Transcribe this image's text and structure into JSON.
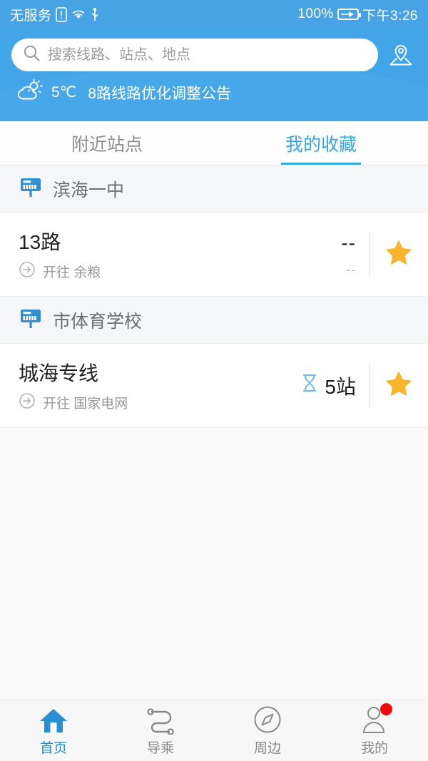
{
  "statusbar": {
    "carrier": "无服务",
    "sim_icon": "sim-alert-icon",
    "wifi_icon": "wifi-icon",
    "usb_icon": "usb-icon",
    "battery_percent": "100%",
    "battery_icon": "battery-charging-icon",
    "time": "下午3:26"
  },
  "header": {
    "search": {
      "icon": "search-icon",
      "placeholder": "搜索线路、站点、地点",
      "value": ""
    },
    "map_icon": "map-pin-icon",
    "weather": {
      "icon": "sun-cloud-icon",
      "temperature": "5℃",
      "notice": "8路线路优化调整公告"
    }
  },
  "tabs": [
    {
      "label": "附近站点",
      "active": false
    },
    {
      "label": "我的收藏",
      "active": true
    }
  ],
  "groups": [
    {
      "station_icon": "bus-stop-sign-icon",
      "station": "滨海一中",
      "routes": [
        {
          "name": "13路",
          "direction_icon": "arrow-right-circle-icon",
          "direction": "开往 余粮",
          "eta_icon": "",
          "eta": "--",
          "eta_sub": "--",
          "favorite_icon": "star-filled-icon",
          "favorite": true
        }
      ]
    },
    {
      "station_icon": "bus-stop-sign-icon",
      "station": "市体育学校",
      "routes": [
        {
          "name": "城海专线",
          "direction_icon": "arrow-right-circle-icon",
          "direction": "开往 国家电网",
          "eta_icon": "hourglass-icon",
          "eta": "5站",
          "eta_sub": "",
          "favorite_icon": "star-filled-icon",
          "favorite": true
        }
      ]
    }
  ],
  "bottomnav": [
    {
      "label": "首页",
      "icon": "home-icon",
      "active": true,
      "badge": false
    },
    {
      "label": "导乘",
      "icon": "route-path-icon",
      "active": false,
      "badge": false
    },
    {
      "label": "周边",
      "icon": "compass-icon",
      "active": false,
      "badge": false
    },
    {
      "label": "我的",
      "icon": "person-icon",
      "active": false,
      "badge": true
    }
  ],
  "colors": {
    "brand_blue": "#41a5e8",
    "status_blue": "#47a3e3",
    "accent_blue": "#35a8e0",
    "star_gold": "#f8b62c",
    "badge_red": "#f00b0b"
  }
}
